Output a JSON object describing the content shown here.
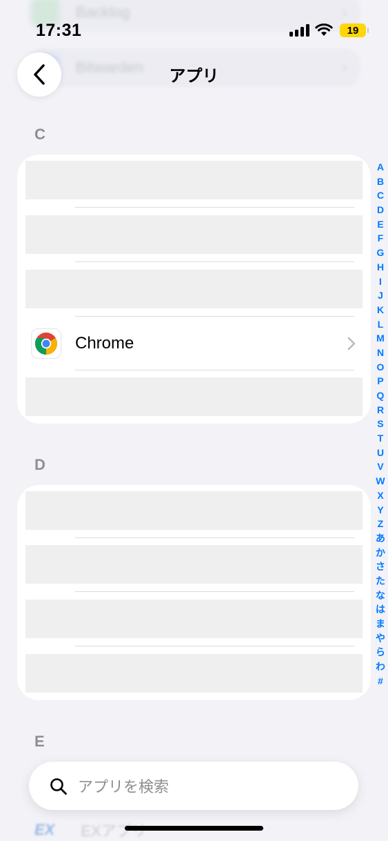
{
  "status_bar": {
    "time": "17:31",
    "battery": "19"
  },
  "nav": {
    "title": "アプリ"
  },
  "ghost_items": [
    {
      "label": "Backlog"
    },
    {
      "label": "Bitwarden"
    }
  ],
  "sections": [
    {
      "header": "C",
      "app_label": "Chrome"
    },
    {
      "header": "D"
    },
    {
      "header": "E"
    }
  ],
  "index_letters": [
    "A",
    "B",
    "C",
    "D",
    "E",
    "F",
    "G",
    "H",
    "I",
    "J",
    "K",
    "L",
    "M",
    "N",
    "O",
    "P",
    "Q",
    "R",
    "S",
    "T",
    "U",
    "V",
    "W",
    "X",
    "Y",
    "Z",
    "あ",
    "か",
    "さ",
    "た",
    "な",
    "は",
    "ま",
    "や",
    "ら",
    "わ",
    "#"
  ],
  "search": {
    "placeholder": "アプリを検索"
  },
  "ghost_bottom": {
    "icon_text": "EX",
    "label": "EXアプリ"
  },
  "colors": {
    "accent": "#007aff",
    "battery": "#ffd60a",
    "background": "#f2f2f7"
  }
}
